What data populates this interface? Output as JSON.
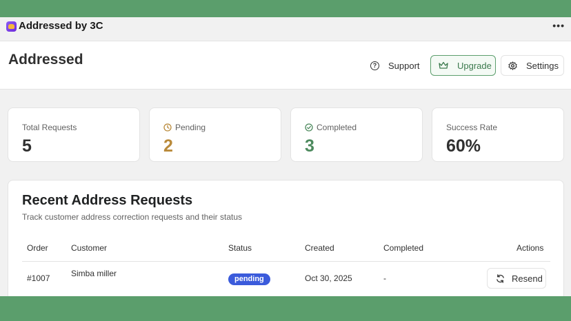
{
  "app": {
    "title": "Addressed by 3C",
    "logo_icon": "app-logo-icon",
    "menu_icon": "more-horizontal-icon",
    "menu_glyph": "•••"
  },
  "header": {
    "title": "Addressed",
    "support_label": "Support",
    "upgrade_label": "Upgrade",
    "settings_label": "Settings"
  },
  "stats": [
    {
      "label": "Total Requests",
      "value": "5",
      "color": "#303030",
      "icon": ""
    },
    {
      "label": "Pending",
      "value": "2",
      "color": "#b98a3a",
      "icon": "clock-icon"
    },
    {
      "label": "Completed",
      "value": "3",
      "color": "#4d8a5e",
      "icon": "check-circle-icon"
    },
    {
      "label": "Success Rate",
      "value": "60%",
      "color": "#303030",
      "icon": ""
    }
  ],
  "recent": {
    "title": "Recent Address Requests",
    "subtitle": "Track customer address correction requests and their status",
    "columns": [
      "Order",
      "Customer",
      "Status",
      "Created",
      "Completed",
      "Actions"
    ],
    "rows": [
      {
        "order": "#1007",
        "customer": "Simba miller",
        "status": "pending",
        "created": "Oct 30, 2025",
        "completed": "-",
        "action_label": "Resend"
      }
    ]
  },
  "colors": {
    "accent": "#5b9e6c",
    "badge": "#3b5bdb",
    "pending": "#b98a3a",
    "completed": "#4d8a5e"
  }
}
